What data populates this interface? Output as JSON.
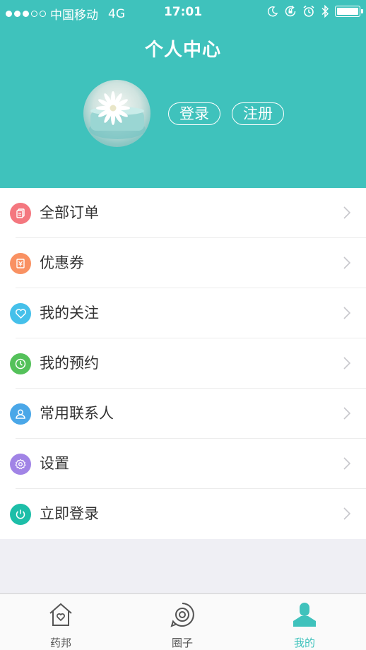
{
  "status_bar": {
    "carrier": "中国移动",
    "network": "4G",
    "time": "17:01"
  },
  "header": {
    "title": "个人中心",
    "login_label": "登录",
    "register_label": "注册"
  },
  "menu": [
    {
      "label": "全部订单",
      "icon": "orders-icon",
      "color": "#f4777f"
    },
    {
      "label": "优惠券",
      "icon": "coupon-icon",
      "color": "#f99162"
    },
    {
      "label": "我的关注",
      "icon": "heart-icon",
      "color": "#45c0ea"
    },
    {
      "label": "我的预约",
      "icon": "clock-icon",
      "color": "#54c15a"
    },
    {
      "label": "常用联系人",
      "icon": "contact-icon",
      "color": "#4aa7e8"
    },
    {
      "label": "设置",
      "icon": "gear-icon",
      "color": "#a184e6"
    },
    {
      "label": "立即登录",
      "icon": "power-icon",
      "color": "#1dbea8"
    }
  ],
  "tabbar": {
    "tabs": [
      {
        "label": "药邦",
        "icon": "home-heart-icon"
      },
      {
        "label": "圈子",
        "icon": "circle-target-icon"
      },
      {
        "label": "我的",
        "icon": "person-icon",
        "active": true
      }
    ],
    "active_color": "#3fc2bc"
  },
  "colors": {
    "brand": "#3fc2bc"
  }
}
